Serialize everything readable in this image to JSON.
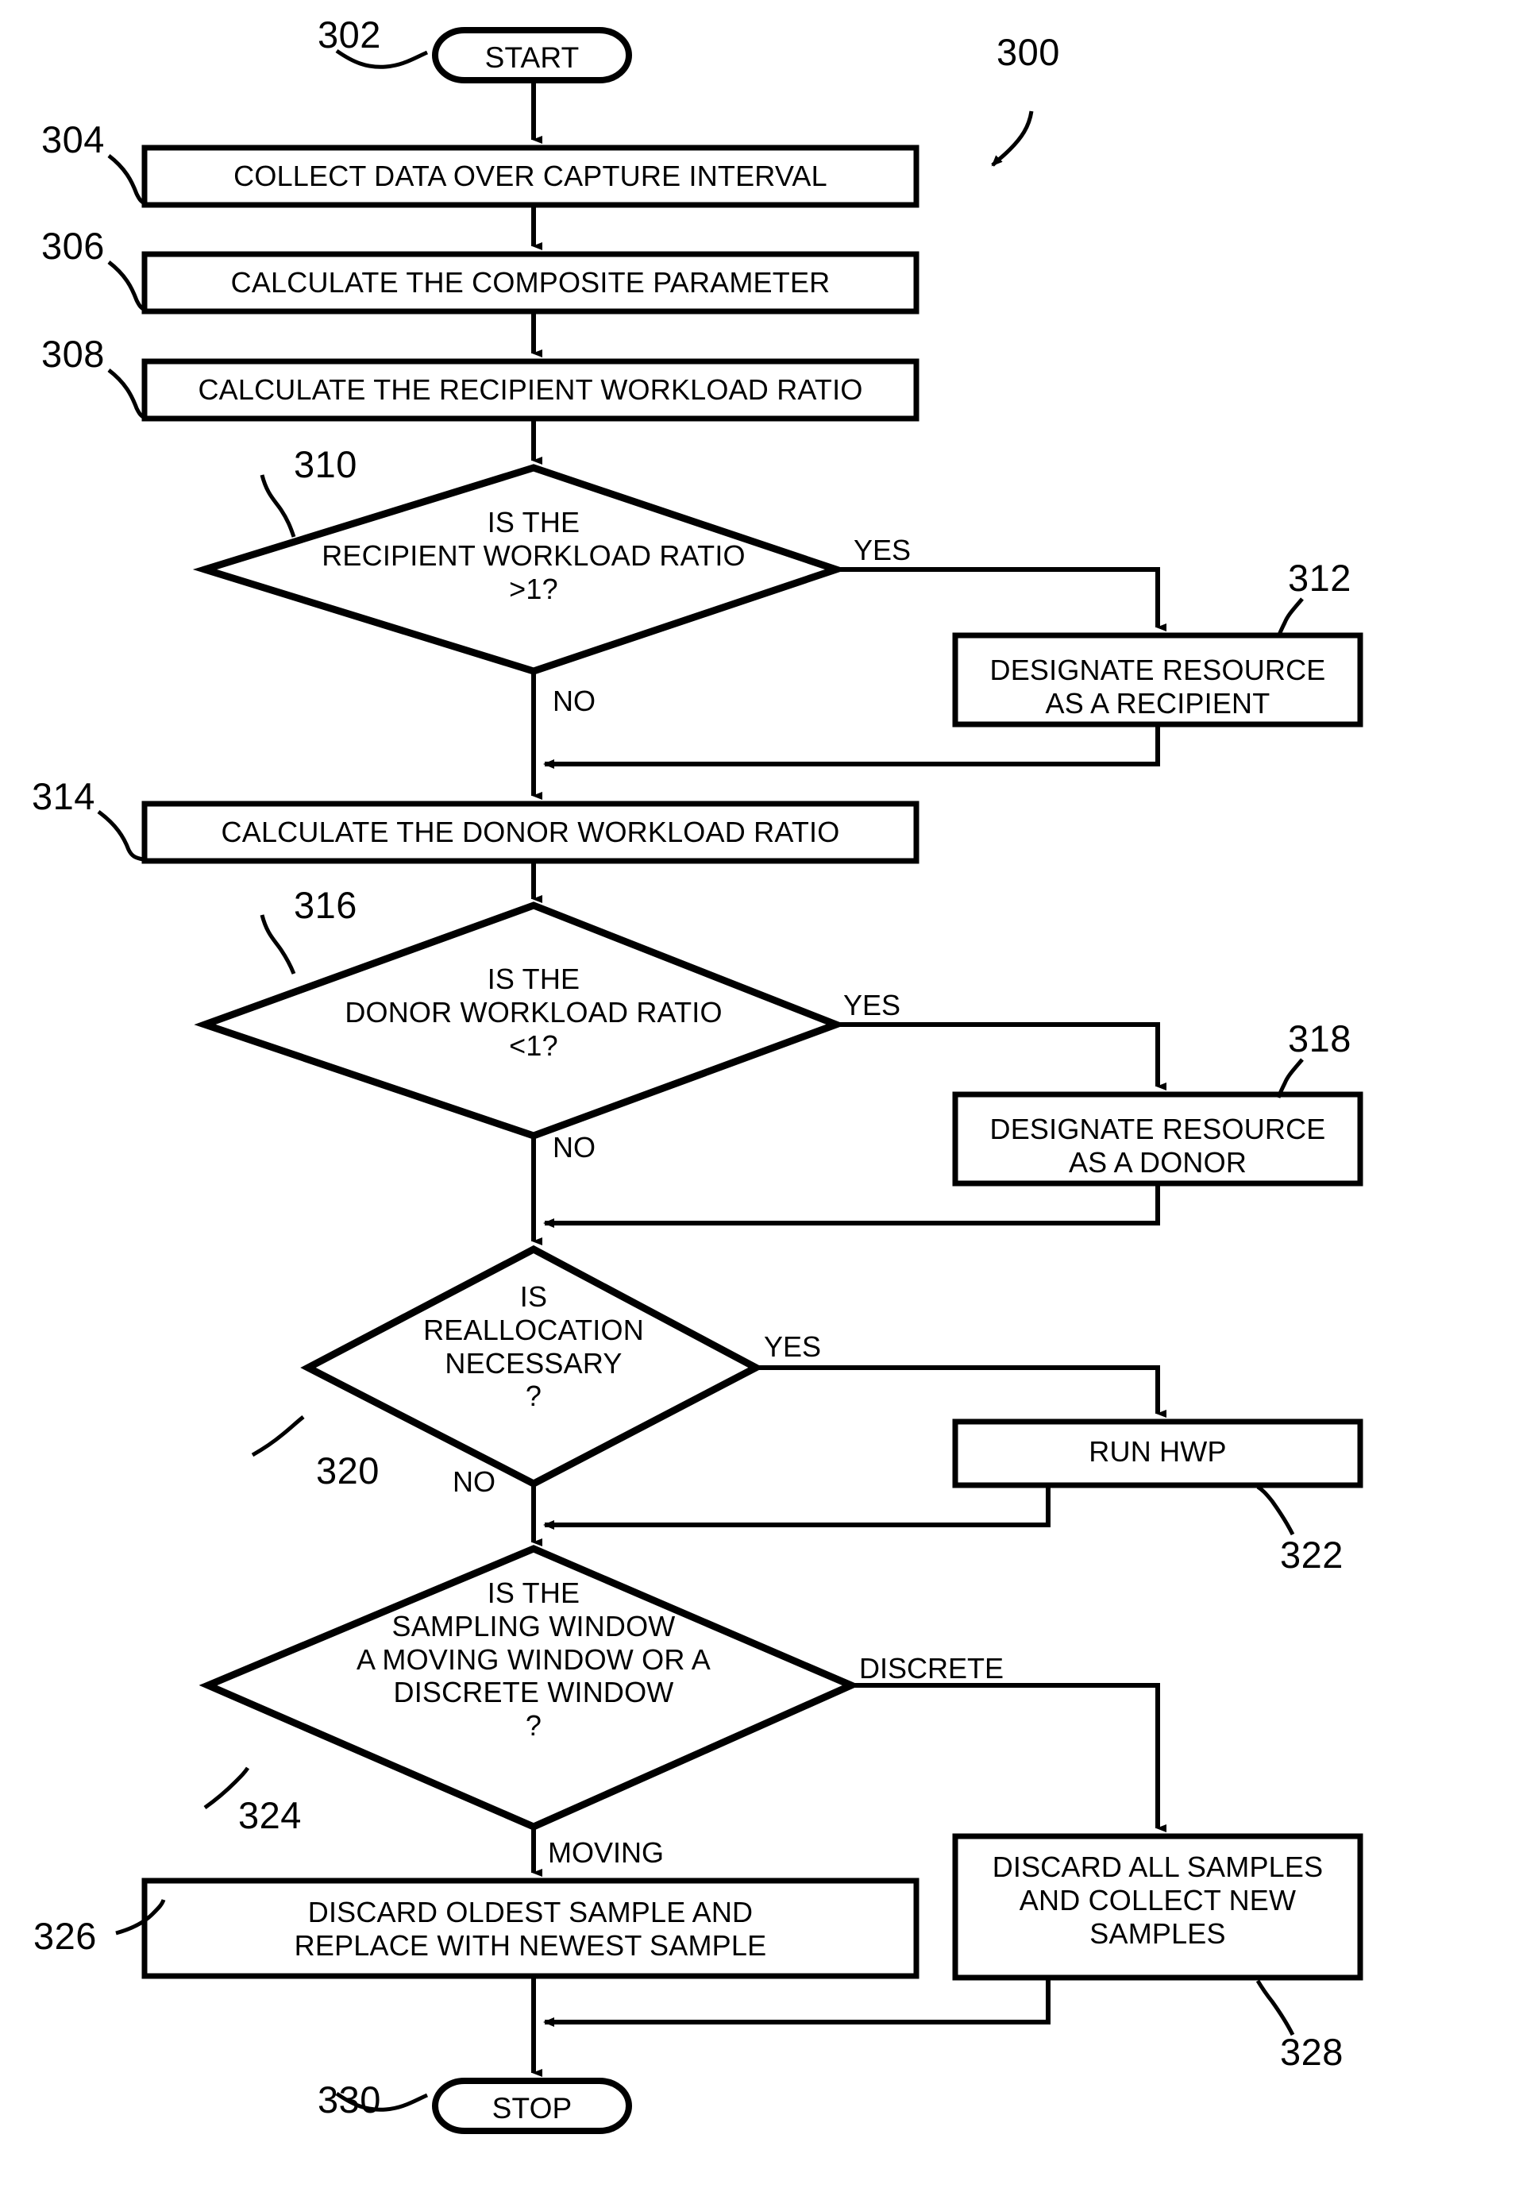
{
  "figure": {
    "number": "300",
    "title": "Workload ratio resource reallocation flowchart"
  },
  "nodes": {
    "start": {
      "ref": "302",
      "label": "START",
      "shape": "terminator"
    },
    "collect_data": {
      "ref": "304",
      "label": "COLLECT DATA OVER CAPTURE INTERVAL",
      "shape": "process"
    },
    "calc_composite": {
      "ref": "306",
      "label": "CALCULATE THE COMPOSITE PARAMETER",
      "shape": "process"
    },
    "calc_recipient_ratio": {
      "ref": "308",
      "label": "CALCULATE THE RECIPIENT WORKLOAD RATIO",
      "shape": "process"
    },
    "decide_recipient": {
      "ref": "310",
      "label": "IS THE\nRECIPIENT WORKLOAD RATIO\n>1?",
      "shape": "decision"
    },
    "designate_recipient": {
      "ref": "312",
      "label": "DESIGNATE RESOURCE\nAS A RECIPIENT",
      "shape": "process"
    },
    "calc_donor_ratio": {
      "ref": "314",
      "label": "CALCULATE THE DONOR WORKLOAD RATIO",
      "shape": "process"
    },
    "decide_donor": {
      "ref": "316",
      "label": "IS THE\nDONOR WORKLOAD RATIO\n<1?",
      "shape": "decision"
    },
    "designate_donor": {
      "ref": "318",
      "label": "DESIGNATE RESOURCE\nAS A DONOR",
      "shape": "process"
    },
    "decide_reallocation": {
      "ref": "320",
      "label": "IS\nREALLOCATION\nNECESSARY\n?",
      "shape": "decision"
    },
    "run_hwp": {
      "ref": "322",
      "label": "RUN HWP",
      "shape": "process"
    },
    "decide_window": {
      "ref": "324",
      "label": "IS THE\nSAMPLING WINDOW\nA MOVING WINDOW OR A\nDISCRETE WINDOW\n?",
      "shape": "decision"
    },
    "discard_oldest": {
      "ref": "326",
      "label": "DISCARD OLDEST SAMPLE AND\nREPLACE WITH NEWEST SAMPLE",
      "shape": "process"
    },
    "discard_all": {
      "ref": "328",
      "label": "DISCARD ALL SAMPLES\nAND COLLECT NEW\nSAMPLES",
      "shape": "process"
    },
    "stop": {
      "ref": "330",
      "label": "STOP",
      "shape": "terminator"
    }
  },
  "edge_labels": {
    "recipient_yes": "YES",
    "recipient_no": "NO",
    "donor_yes": "YES",
    "donor_no": "NO",
    "reallocation_yes": "YES",
    "reallocation_no": "NO",
    "window_discrete": "DISCRETE",
    "window_moving": "MOVING"
  },
  "colors": {
    "stroke": "#000000",
    "fill": "#ffffff",
    "background": "#ffffff"
  }
}
